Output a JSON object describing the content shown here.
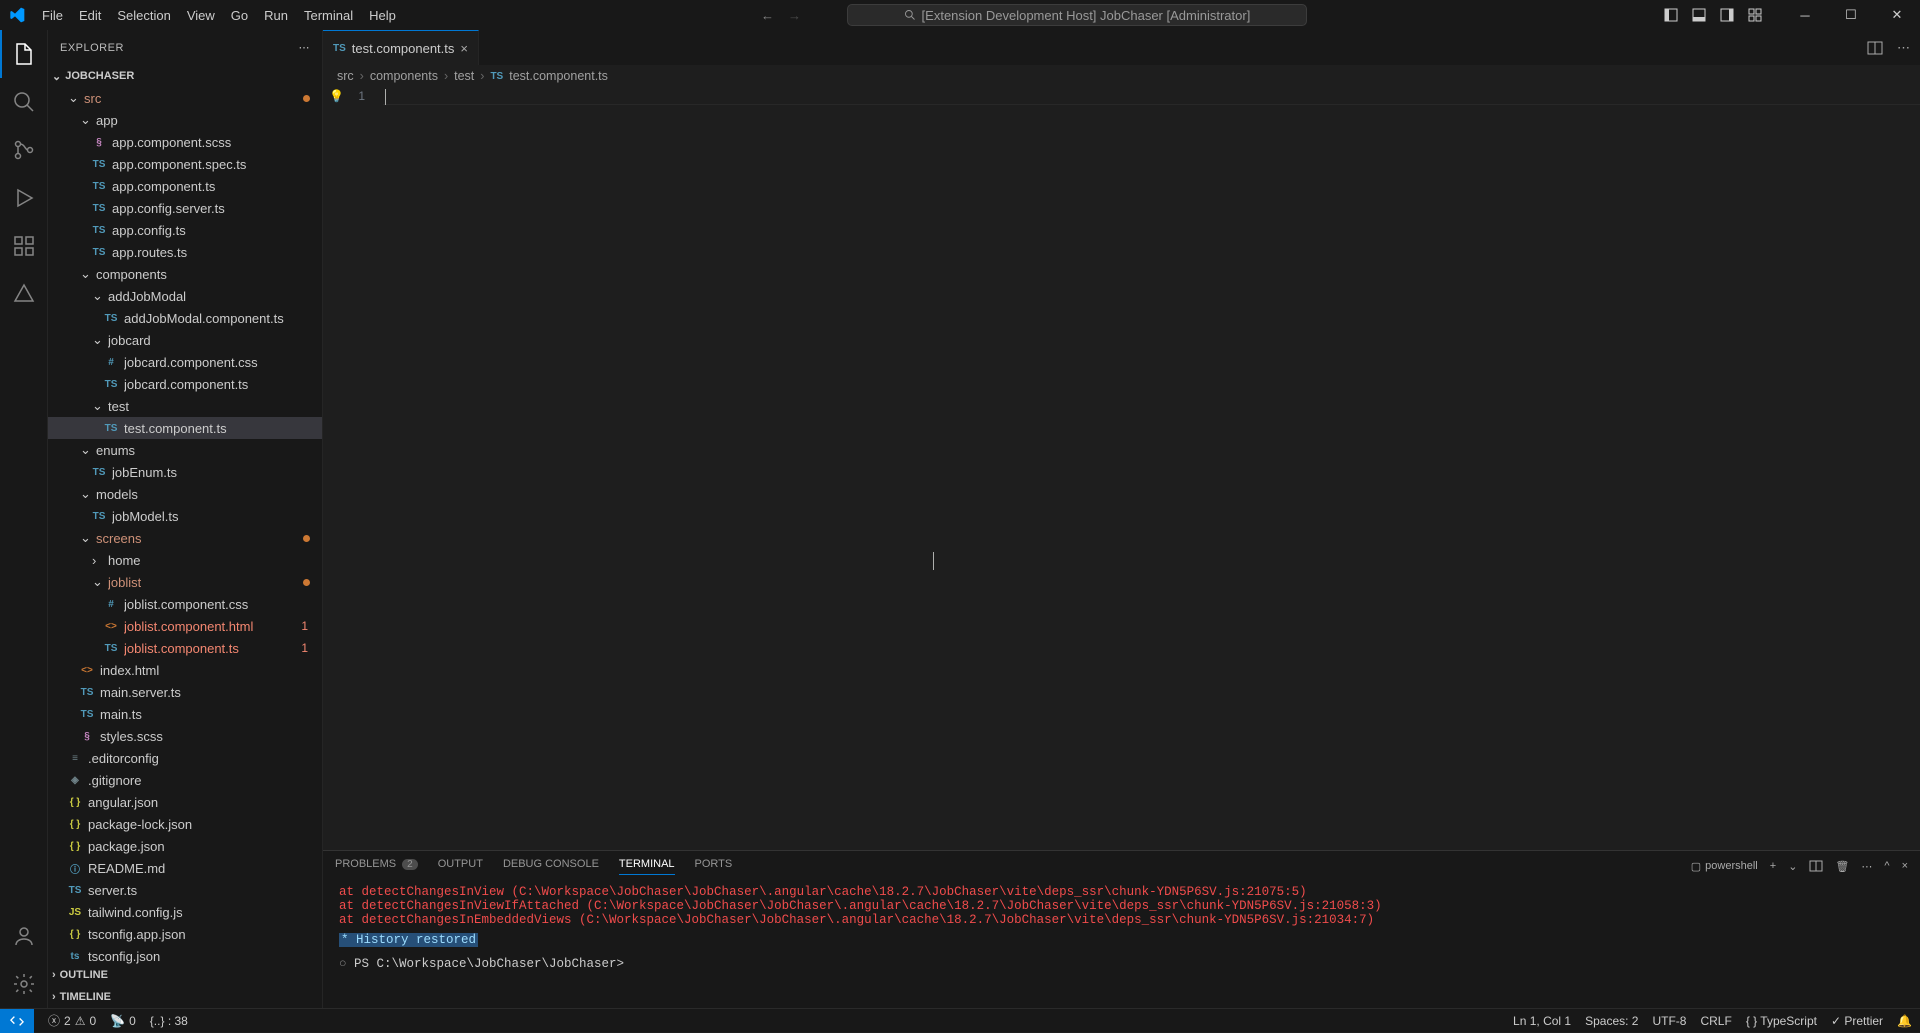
{
  "title": {
    "search_text": "[Extension Development Host] JobChaser [Administrator]"
  },
  "menubar": [
    "File",
    "Edit",
    "Selection",
    "View",
    "Go",
    "Run",
    "Terminal",
    "Help"
  ],
  "sidebar": {
    "title": "EXPLORER",
    "project": "JOBCHASER",
    "tree": [
      {
        "depth": 1,
        "type": "folder",
        "open": true,
        "label": "src",
        "cls": "txt-orange",
        "dot": true
      },
      {
        "depth": 2,
        "type": "folder",
        "open": true,
        "label": "app"
      },
      {
        "depth": 3,
        "type": "file",
        "icon": "scss",
        "label": "app.component.scss",
        "iconcls": "c-pink"
      },
      {
        "depth": 3,
        "type": "file",
        "icon": "ts",
        "label": "app.component.spec.ts",
        "iconcls": "c-blue"
      },
      {
        "depth": 3,
        "type": "file",
        "icon": "ts",
        "label": "app.component.ts",
        "iconcls": "c-blue"
      },
      {
        "depth": 3,
        "type": "file",
        "icon": "ts",
        "label": "app.config.server.ts",
        "iconcls": "c-blue"
      },
      {
        "depth": 3,
        "type": "file",
        "icon": "ts",
        "label": "app.config.ts",
        "iconcls": "c-blue"
      },
      {
        "depth": 3,
        "type": "file",
        "icon": "ts",
        "label": "app.routes.ts",
        "iconcls": "c-blue"
      },
      {
        "depth": 2,
        "type": "folder",
        "open": true,
        "label": "components"
      },
      {
        "depth": 3,
        "type": "folder",
        "open": true,
        "label": "addJobModal"
      },
      {
        "depth": 4,
        "type": "file",
        "icon": "ts",
        "label": "addJobModal.component.ts",
        "iconcls": "c-blue"
      },
      {
        "depth": 3,
        "type": "folder",
        "open": true,
        "label": "jobcard"
      },
      {
        "depth": 4,
        "type": "file",
        "icon": "css",
        "label": "jobcard.component.css",
        "iconcls": "c-blue"
      },
      {
        "depth": 4,
        "type": "file",
        "icon": "ts",
        "label": "jobcard.component.ts",
        "iconcls": "c-blue"
      },
      {
        "depth": 3,
        "type": "folder",
        "open": true,
        "label": "test"
      },
      {
        "depth": 4,
        "type": "file",
        "icon": "ts",
        "label": "test.component.ts",
        "iconcls": "c-blue",
        "selected": true
      },
      {
        "depth": 2,
        "type": "folder",
        "open": true,
        "label": "enums"
      },
      {
        "depth": 3,
        "type": "file",
        "icon": "ts",
        "label": "jobEnum.ts",
        "iconcls": "c-blue"
      },
      {
        "depth": 2,
        "type": "folder",
        "open": true,
        "label": "models"
      },
      {
        "depth": 3,
        "type": "file",
        "icon": "ts",
        "label": "jobModel.ts",
        "iconcls": "c-blue"
      },
      {
        "depth": 2,
        "type": "folder",
        "open": true,
        "label": "screens",
        "cls": "txt-orange",
        "dot": true
      },
      {
        "depth": 3,
        "type": "folder",
        "open": false,
        "label": "home"
      },
      {
        "depth": 3,
        "type": "folder",
        "open": true,
        "label": "joblist",
        "cls": "txt-orange",
        "dot": true
      },
      {
        "depth": 4,
        "type": "file",
        "icon": "css",
        "label": "joblist.component.css",
        "iconcls": "c-blue"
      },
      {
        "depth": 4,
        "type": "file",
        "icon": "html",
        "label": "joblist.component.html",
        "iconcls": "c-orange",
        "cls": "txt-err",
        "err": "1"
      },
      {
        "depth": 4,
        "type": "file",
        "icon": "ts",
        "label": "joblist.component.ts",
        "iconcls": "c-blue",
        "cls": "txt-err",
        "err": "1"
      },
      {
        "depth": 2,
        "type": "file",
        "icon": "html",
        "label": "index.html",
        "iconcls": "c-orange"
      },
      {
        "depth": 2,
        "type": "file",
        "icon": "ts",
        "label": "main.server.ts",
        "iconcls": "c-blue"
      },
      {
        "depth": 2,
        "type": "file",
        "icon": "ts",
        "label": "main.ts",
        "iconcls": "c-blue"
      },
      {
        "depth": 2,
        "type": "file",
        "icon": "scss",
        "label": "styles.scss",
        "iconcls": "c-pink"
      },
      {
        "depth": 1,
        "type": "file",
        "icon": "cfg",
        "label": ".editorconfig",
        "iconcls": "c-gray"
      },
      {
        "depth": 1,
        "type": "file",
        "icon": "git",
        "label": ".gitignore",
        "iconcls": "c-gray"
      },
      {
        "depth": 1,
        "type": "file",
        "icon": "json",
        "label": "angular.json",
        "iconcls": "c-yellow"
      },
      {
        "depth": 1,
        "type": "file",
        "icon": "json",
        "label": "package-lock.json",
        "iconcls": "c-yellow"
      },
      {
        "depth": 1,
        "type": "file",
        "icon": "json",
        "label": "package.json",
        "iconcls": "c-yellow"
      },
      {
        "depth": 1,
        "type": "file",
        "icon": "info",
        "label": "README.md",
        "iconcls": "c-blue"
      },
      {
        "depth": 1,
        "type": "file",
        "icon": "ts",
        "label": "server.ts",
        "iconcls": "c-blue"
      },
      {
        "depth": 1,
        "type": "file",
        "icon": "js",
        "label": "tailwind.config.js",
        "iconcls": "c-yellow"
      },
      {
        "depth": 1,
        "type": "file",
        "icon": "json",
        "label": "tsconfig.app.json",
        "iconcls": "c-yellow"
      },
      {
        "depth": 1,
        "type": "file",
        "icon": "tscfg",
        "label": "tsconfig.json",
        "iconcls": "c-blue"
      }
    ],
    "sections": {
      "outline": "OUTLINE",
      "timeline": "TIMELINE"
    }
  },
  "editor": {
    "tab": {
      "icon": "TS",
      "label": "test.component.ts"
    },
    "breadcrumb": [
      "src",
      "components",
      "test",
      "test.component.ts"
    ],
    "line_no": "1"
  },
  "panel": {
    "tabs": {
      "problems": "PROBLEMS",
      "problems_count": "2",
      "output": "OUTPUT",
      "debug": "DEBUG CONSOLE",
      "terminal": "TERMINAL",
      "ports": "PORTS"
    },
    "shell": "powershell",
    "lines": [
      {
        "cls": "term-err",
        "text": "    at detectChangesInView (C:\\Workspace\\JobChaser\\JobChaser\\.angular\\cache\\18.2.7\\JobChaser\\vite\\deps_ssr\\chunk-YDN5P6SV.js:21075:5)"
      },
      {
        "cls": "term-err",
        "text": "    at detectChangesInViewIfAttached (C:\\Workspace\\JobChaser\\JobChaser\\.angular\\cache\\18.2.7\\JobChaser\\vite\\deps_ssr\\chunk-YDN5P6SV.js:21058:3)"
      },
      {
        "cls": "term-err",
        "text": "    at detectChangesInEmbeddedViews (C:\\Workspace\\JobChaser\\JobChaser\\.angular\\cache\\18.2.7\\JobChaser\\vite\\deps_ssr\\chunk-YDN5P6SV.js:21034:7)"
      }
    ],
    "history": " * History restored ",
    "prompt": "PS C:\\Workspace\\JobChaser\\JobChaser> "
  },
  "statusbar": {
    "errors": "2",
    "warnings": "0",
    "ports": "0",
    "json_sel": "{..} : 38",
    "pos": "Ln 1, Col 1",
    "spaces": "Spaces: 2",
    "enc": "UTF-8",
    "eol": "CRLF",
    "lang": "{ } TypeScript",
    "prettier": "✓  Prettier"
  }
}
